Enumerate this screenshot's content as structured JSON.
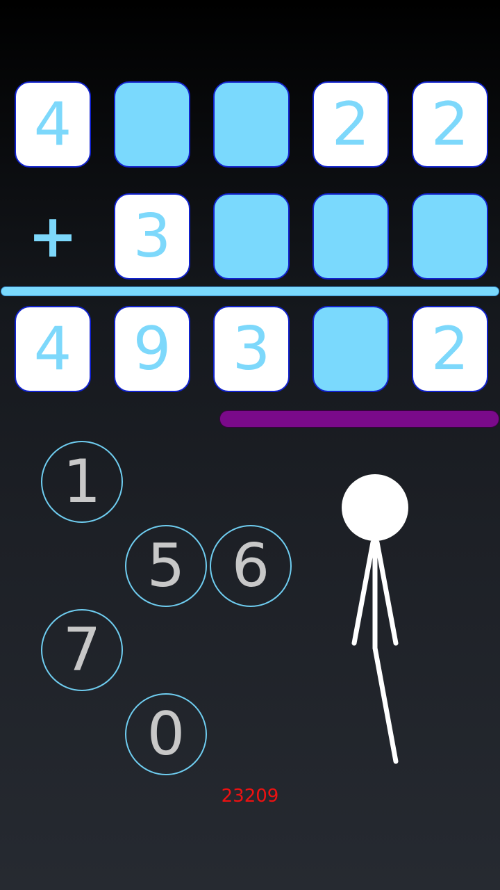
{
  "puzzle": {
    "row1": [
      {
        "value": "4",
        "filled": true
      },
      {
        "value": "",
        "filled": false
      },
      {
        "value": "",
        "filled": false
      },
      {
        "value": "2",
        "filled": true
      },
      {
        "value": "2",
        "filled": true
      }
    ],
    "operator": "+",
    "row2": [
      {
        "value": "3",
        "filled": true
      },
      {
        "value": "",
        "filled": false
      },
      {
        "value": "",
        "filled": false
      },
      {
        "value": "",
        "filled": false
      }
    ],
    "result": [
      {
        "value": "4",
        "filled": true
      },
      {
        "value": "9",
        "filled": true
      },
      {
        "value": "3",
        "filled": true
      },
      {
        "value": "",
        "filled": false
      },
      {
        "value": "2",
        "filled": true
      }
    ]
  },
  "timer": {
    "remaining_fraction": 0.56,
    "color": "#7a0a8a"
  },
  "digit_buttons": [
    "1",
    "5",
    "6",
    "7",
    "0"
  ],
  "score": "23209",
  "colors": {
    "tile_filled": "#ffffff",
    "tile_empty": "#7ad9fd",
    "digit_text": "#7dd8fb",
    "score": "#ee1111"
  }
}
